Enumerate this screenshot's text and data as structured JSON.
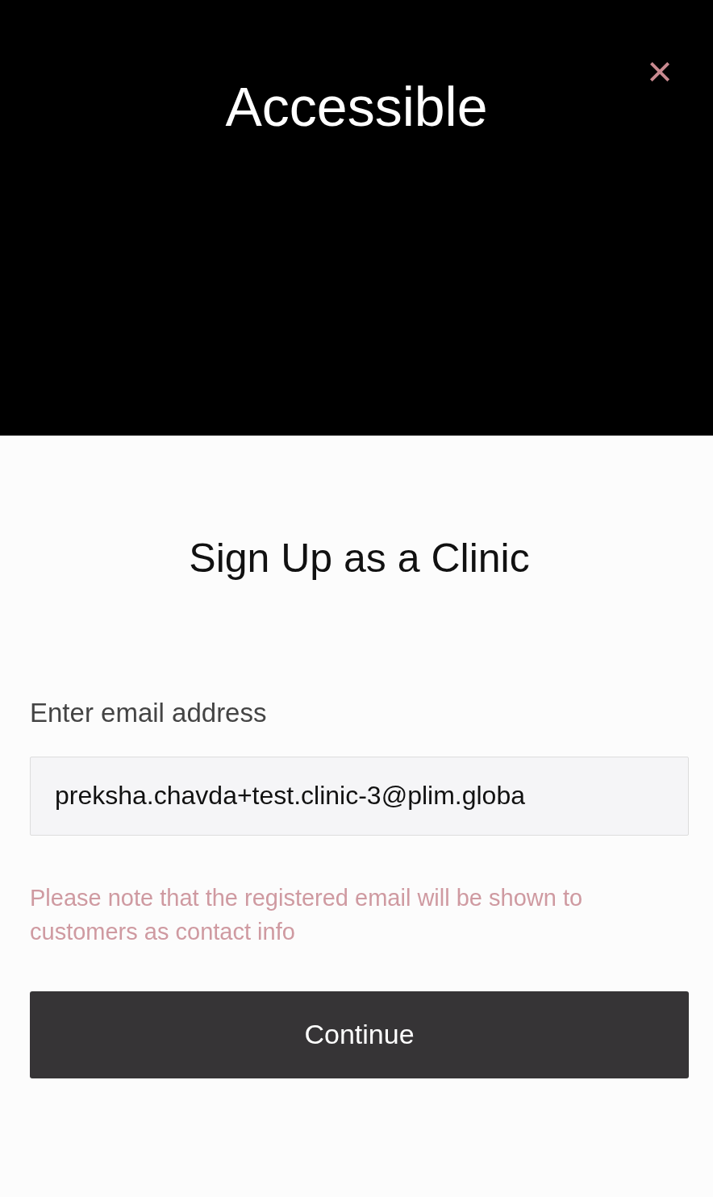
{
  "header": {
    "title": "Accessible",
    "close": "×"
  },
  "form": {
    "heading": "Sign Up as a Clinic",
    "email_label": "Enter email address",
    "email_value": "preksha.chavda+test.clinic-3@plim.globa",
    "note": "Please note that the registered email will be shown to customers as contact info",
    "submit": "Continue"
  }
}
